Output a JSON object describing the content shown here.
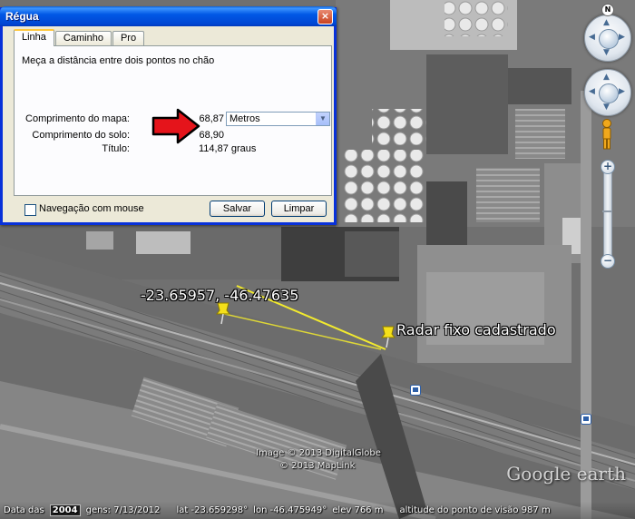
{
  "dialog": {
    "title": "Régua",
    "close_symbol": "×",
    "tabs": [
      "Linha",
      "Caminho",
      "Pro"
    ],
    "active_tab": "Linha",
    "instruction": "Meça a distância entre dois pontos no chão",
    "map_length": {
      "label": "Comprimento do mapa:",
      "value": "68,87",
      "unit": "Metros"
    },
    "ground_length": {
      "label": "Comprimento do solo:",
      "value": "68,90"
    },
    "heading": {
      "label": "Título:",
      "value": "114,87 graus"
    },
    "mouse_nav_label": "Navegação com mouse",
    "mouse_nav_checked": false,
    "save_label": "Salvar",
    "clear_label": "Limpar"
  },
  "map": {
    "placemark_coords_label": "-23.65957, -46.47635",
    "placemark_radar_label": "Radar fixo cadastrado",
    "credit_image": "Image © 2013 DigitalGlobe",
    "credit_maplink": "© 2013 MapLink",
    "watermark": "Google earth",
    "ruler_color": "#f2ea2e",
    "pin_color": "#f5e01a"
  },
  "status": {
    "imagery_prefix": "Data das",
    "imagery_year": "2004",
    "imagery_suffix": "gens: 7/13/2012",
    "lat": "lat -23.659298°",
    "lon": "lon -46.475949°",
    "elev": "elev 766 m",
    "eye_alt": "altitude do ponto de visão 987 m"
  },
  "nav": {
    "north_label": "N",
    "zoom_in": "+",
    "zoom_out": "−"
  }
}
